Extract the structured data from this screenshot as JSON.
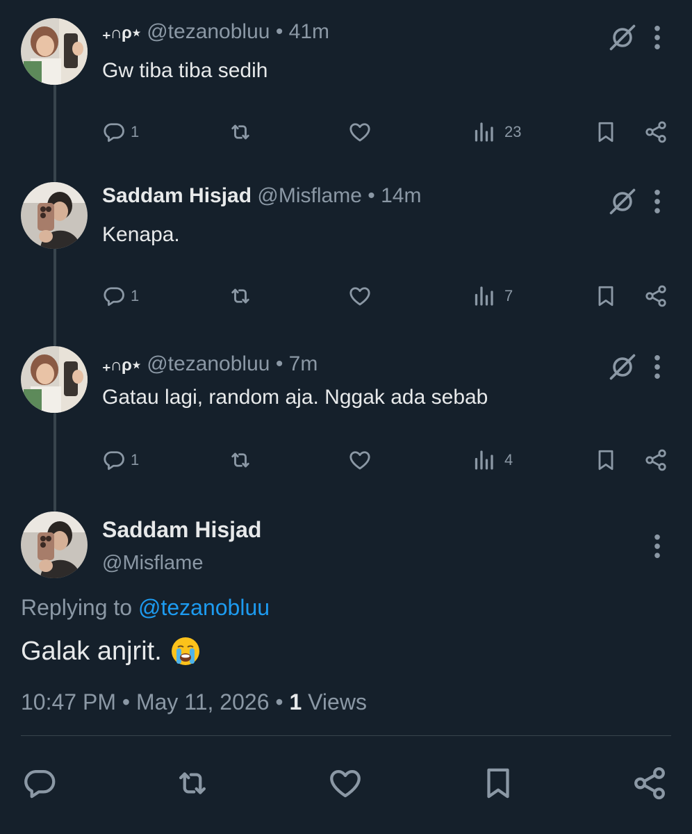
{
  "replies": [
    {
      "author_symbol": "₊∩ρ⋆",
      "handle": "@tezanobluu",
      "dot": "•",
      "time": "41m",
      "text": "Gw tiba tiba sedih",
      "replies_count": "1",
      "views_count": "23",
      "avatar": "avatar-girl"
    },
    {
      "author_name": "Saddam Hisjad",
      "handle": "@Misflame",
      "dot": "•",
      "time": "14m",
      "text": "Kenapa.",
      "replies_count": "1",
      "views_count": "7",
      "avatar": "avatar-mirror-selfie"
    },
    {
      "author_symbol": "₊∩ρ⋆",
      "handle": "@tezanobluu",
      "dot": "•",
      "time": "7m",
      "text": "Gatau lagi, random aja. Nggak ada sebab",
      "replies_count": "1",
      "views_count": "4",
      "avatar": "avatar-girl"
    }
  ],
  "main_tweet": {
    "author_name": "Saddam Hisjad",
    "handle": "@Misflame",
    "replying_prefix": "Replying to",
    "replying_to": "@tezanobluu",
    "text": "Galak anjrit.",
    "emoji": "loudly-crying-face",
    "time": "10:47 PM",
    "date": "May 11, 2026",
    "dot": "•",
    "views_count": "1",
    "views_label": "Views"
  },
  "icons": {
    "reply": "reply-icon",
    "retweet": "retweet-icon",
    "like": "like-icon",
    "views": "views-icon",
    "bookmark": "bookmark-icon",
    "share": "share-icon",
    "grok": "grok-icon",
    "more": "more-icon"
  },
  "colors": {
    "background": "#15202b",
    "primary_text": "#e7e9ea",
    "secondary_text": "#8b98a5",
    "link": "#1d9bf0",
    "divider": "#38444d"
  }
}
